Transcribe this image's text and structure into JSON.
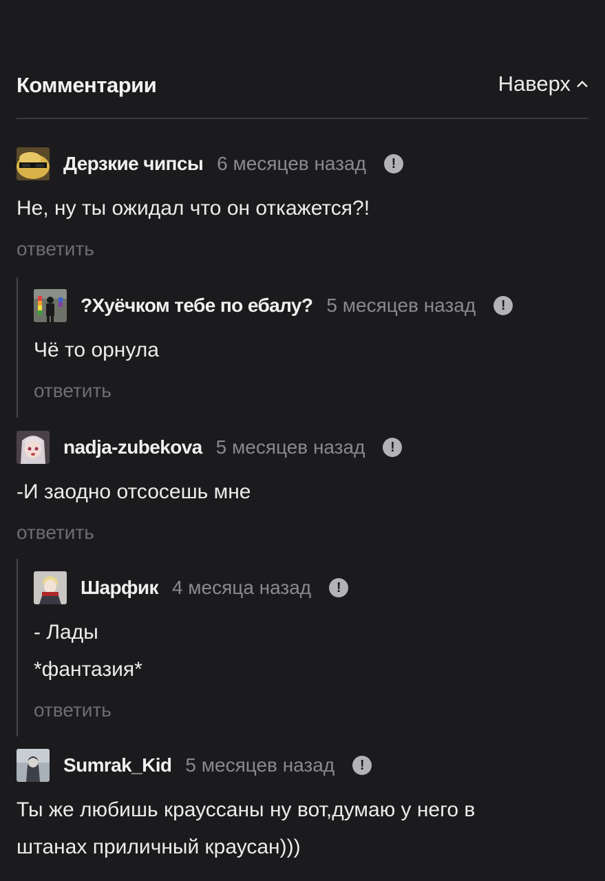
{
  "header": {
    "title": "Комментарии",
    "scroll_top_label": "Наверх"
  },
  "reply_label": "ответить",
  "comments": [
    {
      "author": "Дерзкие чипсы",
      "time": "6 месяцев назад",
      "text": [
        "Не, ну ты ожидал что он откажется?!"
      ],
      "avatar_icon": "chips-with-sunglasses-avatar"
    },
    {
      "author": "?Хуёчком тебе по ебалу?",
      "time": "5 месяцев назад",
      "text": [
        "Чё то орнула"
      ],
      "avatar_icon": "person-with-rainbow-flag-avatar"
    },
    {
      "author": "nadja-zubekova",
      "time": "5 месяцев назад",
      "text": [
        "-И заодно отсосешь мне"
      ],
      "avatar_icon": "anime-girl-avatar"
    },
    {
      "author": "Шарфик",
      "time": "4 месяца назад",
      "text": [
        "- Лады",
        "*фантазия*"
      ],
      "avatar_icon": "anime-boy-scarf-avatar"
    },
    {
      "author": "Sumrak_Kid",
      "time": "5 месяцев назад",
      "text": [
        "Ты же любишь крауссаны ну вот,думаю у него в",
        "штанах приличный краусан)))"
      ],
      "avatar_icon": "dark-figure-avatar"
    }
  ],
  "colors": {
    "background": "#1b1b1d",
    "text": "#ececec",
    "muted": "#8a8a8d",
    "reply": "#6e6e72",
    "thread_line": "#48484b"
  }
}
